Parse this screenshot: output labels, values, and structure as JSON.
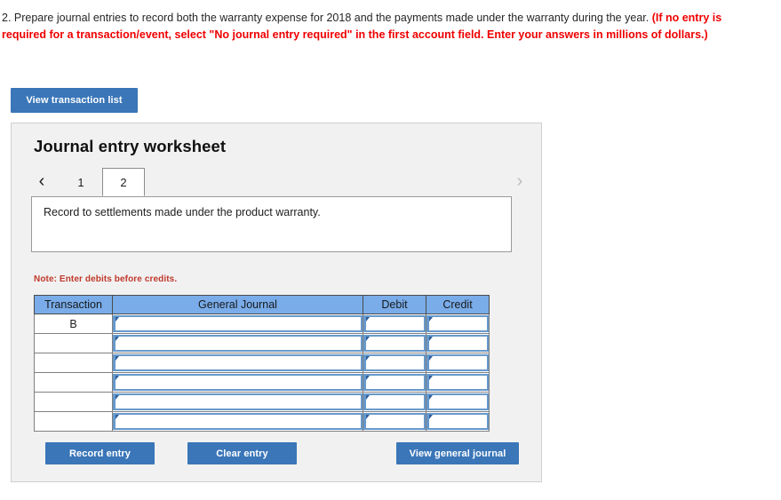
{
  "prompt": {
    "normal_text": "2. Prepare journal entries to record both the warranty expense for 2018 and the payments made under the warranty during the year. ",
    "emphasis_text": "(If no entry is required for a transaction/event, select \"No journal entry required\" in the first account field. Enter your answers in millions of dollars.)",
    "emphasis_color": "#ef0000"
  },
  "toolbar": {
    "view_transaction_list_label": "View transaction list"
  },
  "worksheet": {
    "title": "Journal entry worksheet",
    "nav": {
      "prev_icon": "‹",
      "next_icon": "›"
    },
    "tabs": [
      {
        "label": "1",
        "active": false
      },
      {
        "label": "2",
        "active": true
      }
    ],
    "description": "Record to settlements made under the product warranty.",
    "note": "Note: Enter debits before credits.",
    "table": {
      "headers": [
        "Transaction",
        "General Journal",
        "Debit",
        "Credit"
      ],
      "rows": [
        {
          "transaction": "B",
          "general_journal": "",
          "debit": "",
          "credit": ""
        },
        {
          "transaction": "",
          "general_journal": "",
          "debit": "",
          "credit": ""
        },
        {
          "transaction": "",
          "general_journal": "",
          "debit": "",
          "credit": ""
        },
        {
          "transaction": "",
          "general_journal": "",
          "debit": "",
          "credit": ""
        },
        {
          "transaction": "",
          "general_journal": "",
          "debit": "",
          "credit": ""
        },
        {
          "transaction": "",
          "general_journal": "",
          "debit": "",
          "credit": ""
        }
      ]
    },
    "footer": {
      "record_entry_label": "Record entry",
      "clear_entry_label": "Clear entry",
      "view_general_journal_label": "View general journal"
    }
  },
  "colors": {
    "button_blue": "#3a76b8",
    "table_header_blue": "#79ace8",
    "panel_bg": "#f1f1f1",
    "note_red": "#c0392b"
  }
}
